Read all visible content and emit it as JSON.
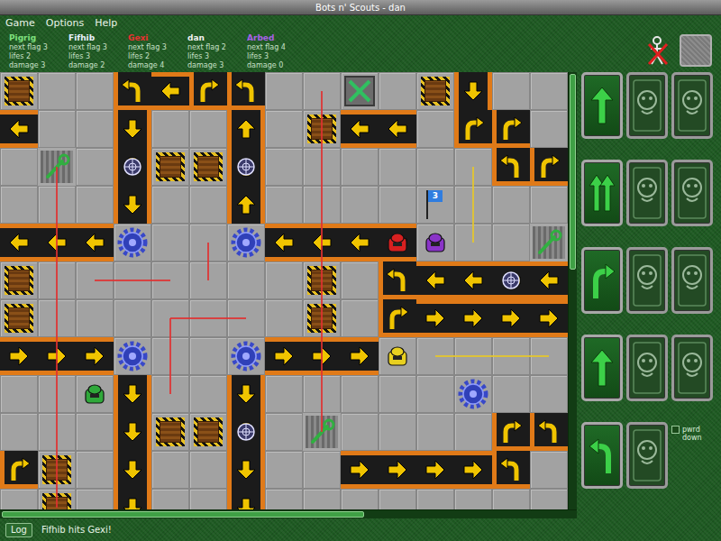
{
  "window": {
    "title": "Bots n' Scouts - dan"
  },
  "menu": [
    "Game",
    "Options",
    "Help"
  ],
  "players": [
    {
      "name": "Pigrig",
      "color": "#7ee07e",
      "stats": [
        "next flag 3",
        "lifes 2",
        "damage 3"
      ],
      "robot": {
        "row": 8,
        "col": 2,
        "color": "#2fa83a"
      }
    },
    {
      "name": "Fifhib",
      "color": "#e8f0ff",
      "stats": [
        "next flag 3",
        "lifes 3",
        "damage 2"
      ],
      "robot": null
    },
    {
      "name": "Gexi",
      "color": "#e83030",
      "stats": [
        "next flag 3",
        "lifes 2",
        "damage 4"
      ],
      "robot": {
        "row": 4,
        "col": 10,
        "color": "#d82020"
      }
    },
    {
      "name": "dan",
      "color": "#f0f0f0",
      "stats": [
        "next flag 2",
        "lifes 3",
        "damage 3"
      ],
      "robot": {
        "row": 7,
        "col": 10,
        "color": "#e8d020"
      }
    },
    {
      "name": "Arbed",
      "color": "#a860e8",
      "stats": [
        "next flag 4",
        "lifes 3",
        "damage 0"
      ],
      "robot": {
        "row": 4,
        "col": 11,
        "color": "#8a34c8"
      }
    }
  ],
  "board": {
    "rows": [
      [
        "crusher",
        "floor",
        "floor",
        "turn-left",
        "belt-left",
        "turn-right",
        "turn-left",
        "floor",
        "floor",
        "pit",
        "floor",
        "crusher",
        "belt-down",
        "floor",
        "floor"
      ],
      [
        "belt-left",
        "floor",
        "floor",
        "belt-down",
        "floor",
        "floor",
        "belt-up",
        "floor",
        "crusher",
        "belt-left",
        "belt-left",
        "floor",
        "turn-right",
        "turn-right",
        "floor"
      ],
      [
        "floor",
        "wrench",
        "floor",
        "belt-down-marker",
        "crusher",
        "crusher",
        "belt-up-marker",
        "floor",
        "floor",
        "floor",
        "floor",
        "floor",
        "floor",
        "turn-left",
        "turn-right"
      ],
      [
        "floor",
        "floor",
        "floor",
        "belt-down",
        "floor",
        "floor",
        "belt-up",
        "floor",
        "floor",
        "floor",
        "floor",
        "floor",
        "floor",
        "floor",
        "floor"
      ],
      [
        "belt-left",
        "belt-left",
        "belt-left",
        "gear",
        "floor",
        "floor",
        "gear",
        "belt-left",
        "belt-left",
        "belt-left",
        "belt-left",
        "floor",
        "floor",
        "floor",
        "wrench"
      ],
      [
        "crusher",
        "floor",
        "floor",
        "floor",
        "floor",
        "floor",
        "floor",
        "floor",
        "crusher",
        "floor",
        "turn-left",
        "belt-left",
        "belt-left",
        "belt-left-marker",
        "belt-left"
      ],
      [
        "crusher",
        "floor",
        "floor",
        "floor",
        "floor",
        "floor",
        "floor",
        "floor",
        "crusher",
        "floor",
        "turn-right",
        "belt-right",
        "belt-right",
        "belt-right",
        "belt-right"
      ],
      [
        "belt-right",
        "belt-right",
        "belt-right",
        "gear",
        "floor",
        "floor",
        "gear",
        "belt-right",
        "belt-right",
        "belt-right",
        "floor",
        "floor",
        "floor",
        "floor",
        "floor"
      ],
      [
        "floor",
        "floor",
        "floor",
        "belt-down",
        "floor",
        "floor",
        "belt-down",
        "floor",
        "floor",
        "floor",
        "floor",
        "floor",
        "gear",
        "floor",
        "floor"
      ],
      [
        "floor",
        "floor",
        "floor",
        "belt-down",
        "crusher",
        "crusher",
        "belt-down-marker",
        "floor",
        "wrench",
        "floor",
        "floor",
        "floor",
        "floor",
        "turn-right",
        "turn-left"
      ],
      [
        "turn-right",
        "crusher",
        "floor",
        "belt-down",
        "floor",
        "floor",
        "belt-down",
        "floor",
        "floor",
        "belt-right",
        "belt-right",
        "belt-right",
        "belt-right",
        "turn-left",
        "floor"
      ],
      [
        "floor",
        "crusher",
        "floor",
        "belt-down",
        "floor",
        "floor",
        "belt-down",
        "floor",
        "floor",
        "floor",
        "floor",
        "floor",
        "floor",
        "floor",
        "floor"
      ]
    ],
    "flags": [
      {
        "label": "3",
        "row": 3,
        "col": 11
      }
    ],
    "lasers": [
      {
        "axis": "vertical",
        "line": 1,
        "from": 2,
        "to": 11,
        "color": "#e03030"
      },
      {
        "axis": "vertical",
        "line": 8,
        "from": 0,
        "to": 9,
        "color": "#e03030"
      },
      {
        "axis": "horizontal",
        "line": 5,
        "from": 2,
        "to": 4,
        "color": "#e03030"
      },
      {
        "axis": "vertical",
        "line": 5,
        "from": 4,
        "to": 5,
        "color": "#e03030"
      },
      {
        "axis": "vertical",
        "line": 4,
        "from": 6,
        "to": 8,
        "color": "#e03030"
      },
      {
        "axis": "horizontal",
        "line": 6,
        "from": 4,
        "to": 6,
        "color": "#e03030"
      },
      {
        "axis": "vertical",
        "line": 12,
        "from": 2,
        "to": 4,
        "color": "#e8c828"
      },
      {
        "axis": "horizontal",
        "line": 7,
        "from": 11,
        "to": 14,
        "color": "#e8c828"
      }
    ]
  },
  "cards": [
    [
      {
        "kind": "move-1"
      },
      {
        "kind": "back"
      },
      {
        "kind": "back"
      }
    ],
    [
      {
        "kind": "move-2"
      },
      {
        "kind": "back"
      },
      {
        "kind": "back"
      }
    ],
    [
      {
        "kind": "turn-right"
      },
      {
        "kind": "back"
      },
      {
        "kind": "back"
      }
    ],
    [
      {
        "kind": "move-1"
      },
      {
        "kind": "back"
      },
      {
        "kind": "back"
      }
    ],
    [
      {
        "kind": "turn-left"
      },
      {
        "kind": "back"
      },
      {
        "kind": "empty"
      }
    ]
  ],
  "power_down": {
    "label": "pwrd down",
    "checked": false
  },
  "status_bar": {
    "button": "Log",
    "message": "Fifhib hits Gexi!"
  }
}
